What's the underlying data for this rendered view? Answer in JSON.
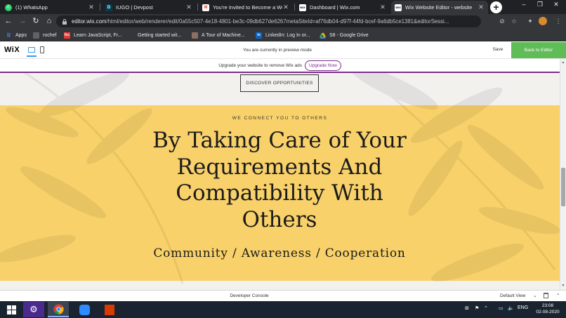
{
  "browser": {
    "tabs": [
      {
        "title": "(1) WhatsApp",
        "favicon": "whatsapp-icon",
        "color": "#25d366",
        "active": false
      },
      {
        "title": "IUGO | Devpost",
        "favicon": "devpost-icon",
        "color": "#003e54",
        "active": false
      },
      {
        "title": "You're Invited to Become a Wel",
        "favicon": "gmail-icon",
        "color": "#ea4335",
        "active": false
      },
      {
        "title": "Dashboard | Wix.com",
        "favicon": "wix-icon",
        "color": "#ffffff",
        "active": false
      },
      {
        "title": "Wix Website Editor - website",
        "favicon": "wix-icon",
        "color": "#ffffff",
        "active": true
      }
    ],
    "url_host": "editor.wix.com",
    "url_path": "/html/editor/web/renderer/edit/0a55c507-4e18-4801-be3c-09db627de6267metaSiteId=af76db04-d97f-44fd-bcef-9a6db5ce1381&editorSessi...",
    "bookmarks": [
      {
        "label": "Apps",
        "icon": "apps-grid-icon",
        "color": "#4285f4"
      },
      {
        "label": "rochef",
        "icon": "bookmark-icon",
        "color": "#5f6368"
      },
      {
        "label": "Learn JavaScript, Fr...",
        "icon": "freecodecamp-icon",
        "color": "#e53935"
      },
      {
        "label": "Getting started wit...",
        "icon": "bookmark-icon",
        "color": "#35363a"
      },
      {
        "label": "A Tour of Machine...",
        "icon": "bookmark-icon",
        "color": "#8d6e63"
      },
      {
        "label": "LinkedIn: Log In or...",
        "icon": "linkedin-icon",
        "color": "#0a66c2"
      },
      {
        "label": "S8 - Google Drive",
        "icon": "google-drive-icon",
        "color": "#fbbc04"
      }
    ]
  },
  "wix": {
    "logo": "WiX",
    "preview_text": "You are currently in preview mode",
    "save_label": "Save",
    "back_label": "Back to Editor",
    "accent": "#60bc57"
  },
  "site": {
    "upgrade_text": "Upgrade your website to remove Wix ads",
    "upgrade_button": "Upgrade Now",
    "discover_button": "DISCOVER OPPORTUNITIES",
    "overline": "WE CONNECT YOU TO OTHERS",
    "headline": "By Taking Care of Your Requirements And Compatibility With Others",
    "subline": "Community / Awareness / Cooperation",
    "section_color": "#f8d16a"
  },
  "devconsole": {
    "label": "Developer Console",
    "view_label": "Default View"
  },
  "taskbar": {
    "apps": [
      "windows-start-icon",
      "settings-app-icon",
      "chrome-icon",
      "zoom-icon",
      "office-icon"
    ],
    "language": "ENG",
    "time": "23:08",
    "date": "02-08-2020"
  }
}
